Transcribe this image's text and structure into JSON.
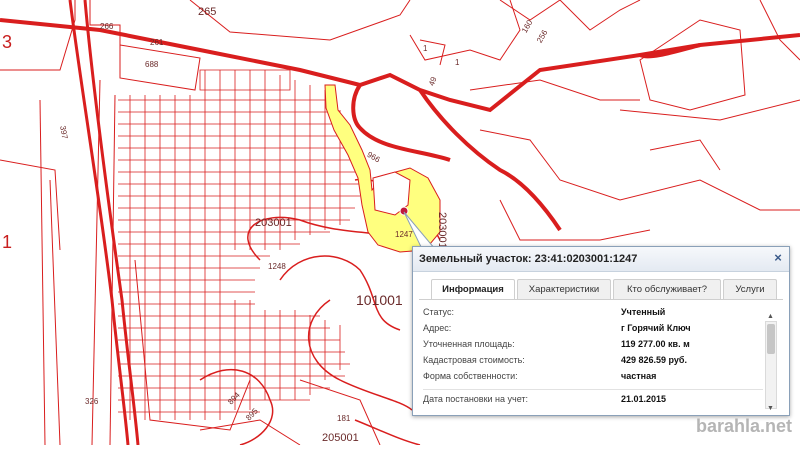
{
  "map": {
    "parcel_labels": [
      "265",
      "266",
      "261",
      "688",
      "1",
      "160",
      "256",
      "1",
      "49",
      "397",
      "966",
      "203001",
      "1247",
      "203001",
      "1248",
      "101001",
      "326",
      "894",
      "895",
      "181",
      "205001",
      "3",
      "1"
    ],
    "highlight_color": "#ffff7f",
    "line_color": "#d91e1e",
    "marker_color": "#c0183c"
  },
  "popup": {
    "title": "Земельный участок: 23:41:0203001:1247",
    "close": "×",
    "tabs": [
      "Информация",
      "Характеристики",
      "Кто обслуживает?",
      "Услуги"
    ],
    "rows": [
      {
        "label": "Статус:",
        "value": "Учтенный"
      },
      {
        "label": "Адрес:",
        "value": "г Горячий Ключ"
      },
      {
        "label": "Уточненная площадь:",
        "value": "119 277.00 кв. м"
      },
      {
        "label": "Кадастровая стоимость:",
        "value": "429 826.59 руб."
      },
      {
        "label": "Форма собственности:",
        "value": "частная"
      },
      {
        "label": "Дата постановки на учет:",
        "value": "21.01.2015"
      }
    ]
  },
  "watermark": "barahla.net"
}
